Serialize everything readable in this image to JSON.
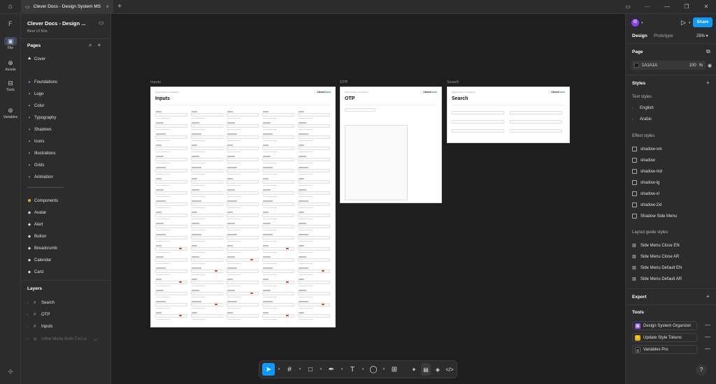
{
  "window": {
    "tab_title": "Clever Docs - Design System MS"
  },
  "rail": {
    "items": [
      {
        "label": "File"
      },
      {
        "label": "Assets"
      },
      {
        "label": "Tools"
      },
      {
        "label": "Variables"
      }
    ]
  },
  "left_panel": {
    "file_title": "Clever Docs - Design ...",
    "file_subtitle": "Best UI Kits",
    "pages_title": "Pages",
    "pages": [
      {
        "label": "Cover",
        "icon": "⛰"
      },
      {
        "label": "Foundations",
        "icon": "●"
      },
      {
        "label": "Logo",
        "icon": "•"
      },
      {
        "label": "Color",
        "icon": "•"
      },
      {
        "label": "Typography",
        "icon": "•"
      },
      {
        "label": "Shadows",
        "icon": "•"
      },
      {
        "label": "Icons",
        "icon": "•"
      },
      {
        "label": "Illustrations",
        "icon": "•"
      },
      {
        "label": "Grids",
        "icon": "•"
      },
      {
        "label": "Animation",
        "icon": "•"
      },
      {
        "label": "Components",
        "icon": "⬢"
      },
      {
        "label": "Avatar",
        "icon": "◆"
      },
      {
        "label": "Alert",
        "icon": "◆"
      },
      {
        "label": "Button",
        "icon": "◆"
      },
      {
        "label": "Breadcrumb",
        "icon": "◆"
      },
      {
        "label": "Calendar",
        "icon": "◆"
      },
      {
        "label": "Card",
        "icon": "◆"
      }
    ],
    "divider_text": "--------------------------",
    "layers_title": "Layers",
    "layers": [
      {
        "label": "Search"
      },
      {
        "label": "OTP"
      },
      {
        "label": "Inputs"
      },
      {
        "label": "Inline-Menu-Both-Txt-Le"
      }
    ]
  },
  "canvas": {
    "frames": [
      {
        "label": "Inputs",
        "title": "Inputs",
        "brand_a": "Clever",
        "brand_b": "Docs"
      },
      {
        "label": "OTP",
        "title": "OTP",
        "brand_a": "Clever",
        "brand_b": "Docs"
      },
      {
        "label": "Search",
        "title": "Search",
        "brand_a": "Clever",
        "brand_b": "Docs"
      }
    ]
  },
  "right_panel": {
    "avatar_letter": "O",
    "share_label": "Share",
    "tabs": [
      "Design",
      "Prototype"
    ],
    "zoom": "25%",
    "page_section": "Page",
    "page_color": "1A1A1A",
    "page_opacity": "100",
    "page_opacity_unit": "%",
    "styles_title": "Styles",
    "text_styles_title": "Text styles",
    "text_styles": [
      "English",
      "Arabic"
    ],
    "effect_styles_title": "Effect styles",
    "effect_styles": [
      "shadow-sm",
      "shadow",
      "shadow-md",
      "shadow-lg",
      "shadow-xl",
      "shadow-2xl",
      "Shadow Side Menu"
    ],
    "layout_styles_title": "Layout guide styles",
    "layout_styles": [
      "Side Menu Close EN",
      "Side Menu Close AR",
      "Side Menu Default EN",
      "Side Menu Default AR"
    ],
    "export_title": "Export",
    "tools_title": "Tools",
    "tools": [
      {
        "label": "Design System Organizer",
        "color": "#8b5cf6"
      },
      {
        "label": "Update Style Tokens",
        "color": "#eab308"
      },
      {
        "label": "Variables Pro",
        "color": "#111111"
      }
    ],
    "help": "?"
  }
}
